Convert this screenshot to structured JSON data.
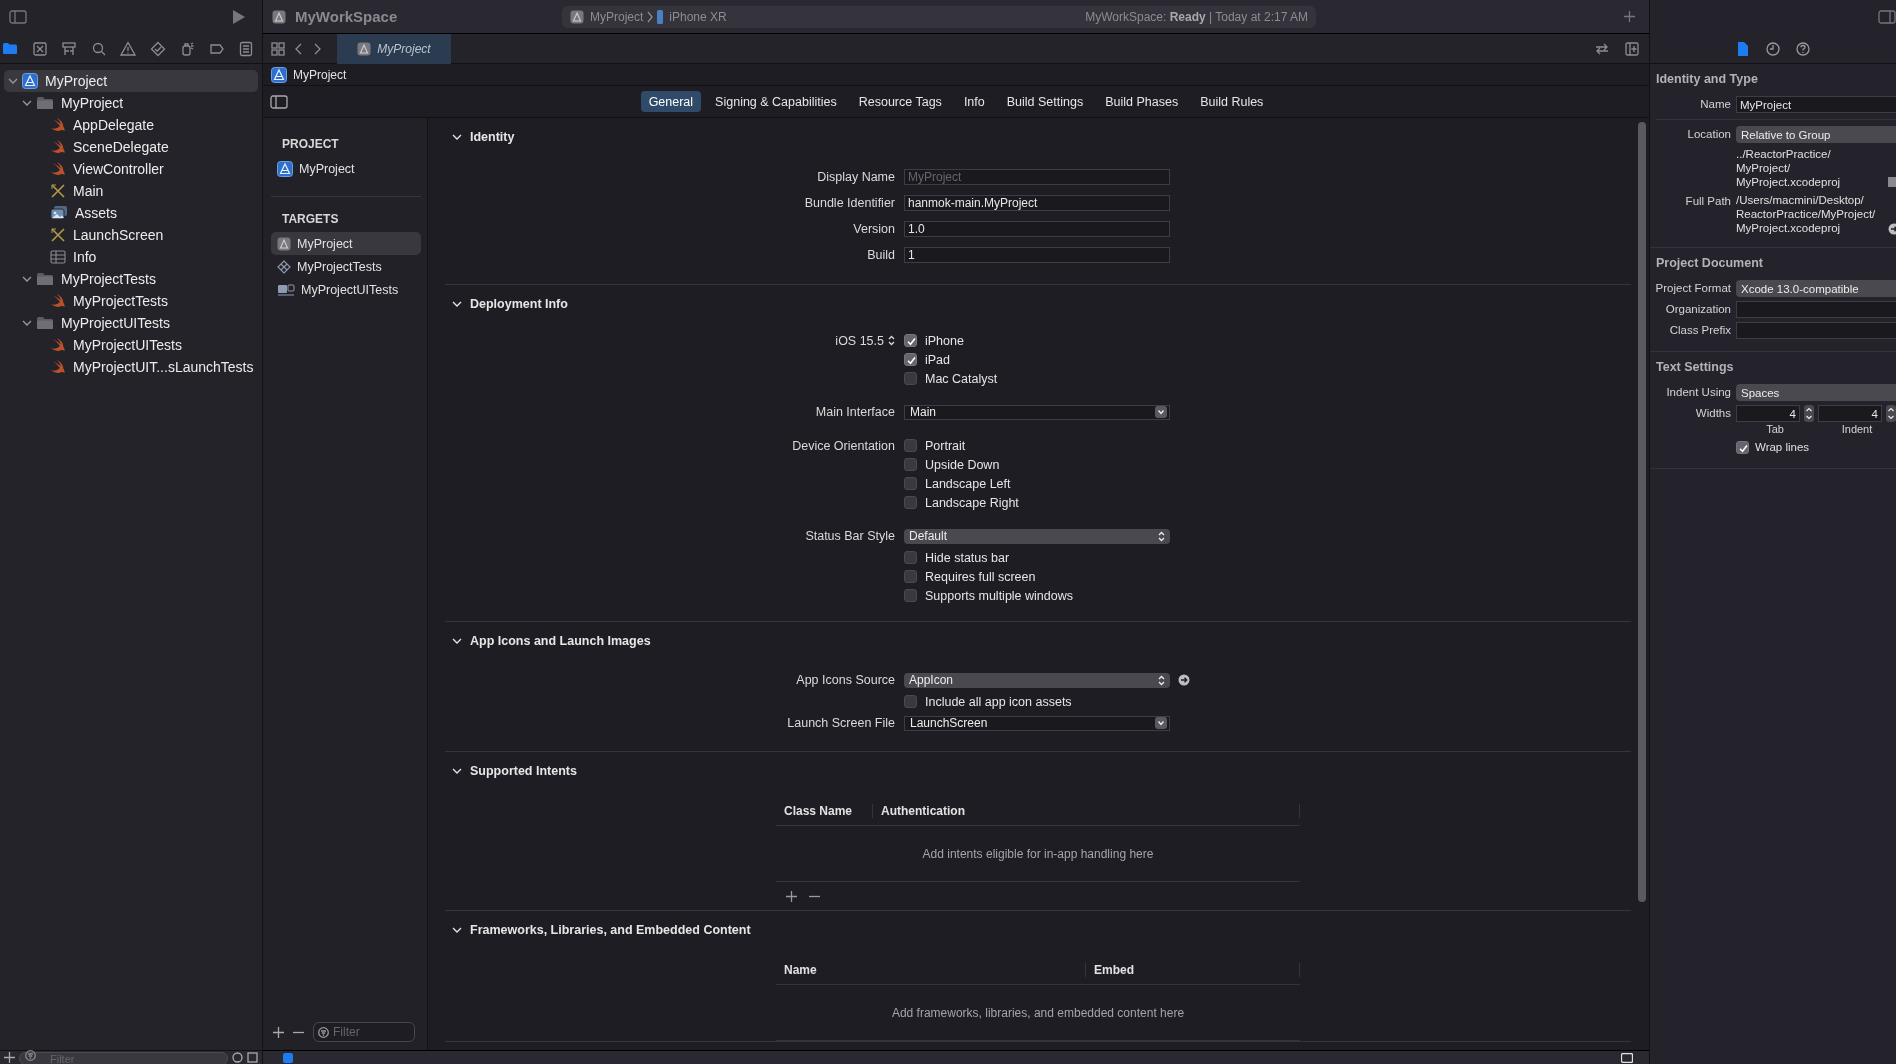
{
  "toolbar": {
    "workspace_title": "MyWorkSpace",
    "scheme": "MyProject",
    "destination": "iPhone XR",
    "status": "MyWorkSpace: **Ready** | Today at 2:17 AM"
  },
  "navigator": {
    "tabs": [
      {
        "kind": "folder",
        "selected": true
      },
      {
        "kind": "source-control",
        "selected": false
      },
      {
        "kind": "hierarchy",
        "selected": false
      },
      {
        "kind": "search",
        "selected": false
      },
      {
        "kind": "warning",
        "selected": false
      },
      {
        "kind": "test",
        "selected": false
      },
      {
        "kind": "debug",
        "selected": false
      },
      {
        "kind": "breakpoint",
        "selected": false
      },
      {
        "kind": "report",
        "selected": false
      }
    ],
    "tree": [
      {
        "name": "MyProject",
        "kind": "project",
        "selected": true,
        "expanded": true,
        "children": [
          {
            "name": "MyProject",
            "kind": "folder",
            "selected": false,
            "expanded": true,
            "children": [
              {
                "name": "AppDelegate",
                "kind": "swift",
                "selected": false
              },
              {
                "name": "SceneDelegate",
                "kind": "swift",
                "selected": false
              },
              {
                "name": "ViewController",
                "kind": "swift",
                "selected": false
              },
              {
                "name": "Main",
                "kind": "storyboard",
                "selected": false
              },
              {
                "name": "Assets",
                "kind": "assets",
                "selected": false
              },
              {
                "name": "LaunchScreen",
                "kind": "storyboard",
                "selected": false
              },
              {
                "name": "Info",
                "kind": "plist",
                "selected": false
              }
            ]
          },
          {
            "name": "MyProjectTests",
            "kind": "folder",
            "selected": false,
            "expanded": true,
            "children": [
              {
                "name": "MyProjectTests",
                "kind": "swift",
                "selected": false
              }
            ]
          },
          {
            "name": "MyProjectUITests",
            "kind": "folder",
            "selected": false,
            "expanded": true,
            "children": [
              {
                "name": "MyProjectUITests",
                "kind": "swift",
                "selected": false
              },
              {
                "name": "MyProjectUIT...sLaunchTests",
                "kind": "swift",
                "selected": false
              }
            ]
          }
        ]
      }
    ],
    "filter_placeholder": "Filter"
  },
  "editor_tabs": [
    {
      "title": "MyProject",
      "selected": true
    }
  ],
  "jump_bar": "MyProject",
  "settings_tabs": [
    {
      "label": "General",
      "selected": true
    },
    {
      "label": "Signing & Capabilities",
      "selected": false
    },
    {
      "label": "Resource Tags",
      "selected": false
    },
    {
      "label": "Info",
      "selected": false
    },
    {
      "label": "Build Settings",
      "selected": false
    },
    {
      "label": "Build Phases",
      "selected": false
    },
    {
      "label": "Build Rules",
      "selected": false
    }
  ],
  "project_list": {
    "project_heading": "PROJECT",
    "projects": [
      {
        "name": "MyProject",
        "kind": "project",
        "selected": false
      }
    ],
    "targets_heading": "TARGETS",
    "targets": [
      {
        "name": "MyProject",
        "kind": "app",
        "selected": true
      },
      {
        "name": "MyProjectTests",
        "kind": "unit-tests",
        "selected": false
      },
      {
        "name": "MyProjectUITests",
        "kind": "ui-tests",
        "selected": false
      }
    ],
    "filter_placeholder": "Filter"
  },
  "sections": [
    {
      "title": "Identity",
      "expanded": true,
      "groups": [
        [
          {
            "kind": "text-field",
            "label": "Display Name",
            "placeholder": "MyProject"
          },
          {
            "kind": "text-field",
            "label": "Bundle Identifier",
            "value": "hanmok-main.MyProject"
          },
          {
            "kind": "text-field",
            "label": "Version",
            "value": "1.0"
          },
          {
            "kind": "text-field",
            "label": "Build",
            "value": "1"
          }
        ]
      ]
    },
    {
      "title": "Deployment Info",
      "expanded": true,
      "groups": [
        [
          {
            "kind": "deployment-target",
            "label": "iOS 15.5",
            "text": "iPhone",
            "checked": true
          },
          {
            "kind": "checkbox",
            "text": "iPad",
            "checked": true
          },
          {
            "kind": "checkbox",
            "text": "Mac Catalyst",
            "checked": false
          }
        ],
        [
          {
            "kind": "combo",
            "label": "Main Interface",
            "value": "Main"
          }
        ],
        [
          {
            "kind": "checkbox",
            "label": "Device Orientation",
            "text": "Portrait",
            "checked": false
          },
          {
            "kind": "checkbox",
            "text": "Upside Down",
            "checked": false
          },
          {
            "kind": "checkbox",
            "text": "Landscape Left",
            "checked": false
          },
          {
            "kind": "checkbox",
            "text": "Landscape Right",
            "checked": false
          }
        ],
        [
          {
            "kind": "popup",
            "label": "Status Bar Style",
            "value": "Default"
          },
          {
            "kind": "checkbox",
            "text": "Hide status bar",
            "checked": false
          },
          {
            "kind": "checkbox",
            "text": "Requires full screen",
            "checked": false
          },
          {
            "kind": "checkbox",
            "text": "Supports multiple windows",
            "checked": false
          }
        ]
      ]
    },
    {
      "title": "App Icons and Launch Images",
      "expanded": true,
      "groups": [
        [
          {
            "kind": "popup-link",
            "label": "App Icons Source",
            "value": "AppIcon"
          },
          {
            "kind": "checkbox",
            "text": "Include all app icon assets",
            "checked": false
          },
          {
            "kind": "combo",
            "label": "Launch Screen File",
            "value": "LaunchScreen"
          }
        ]
      ]
    },
    {
      "title": "Supported Intents",
      "expanded": true,
      "table": {
        "columns": [
          "Class Name",
          "Authentication"
        ],
        "empty_message": "Add intents eligible for in-app handling here",
        "add_remove_buttons": true
      }
    },
    {
      "title": "Frameworks, Libraries, and Embedded Content",
      "expanded": true,
      "table": {
        "columns": [
          "Name",
          "Embed"
        ],
        "empty_message": "Add frameworks, libraries, and embedded content here"
      }
    }
  ],
  "inspector": {
    "tabs": [
      {
        "kind": "file",
        "selected": true
      },
      {
        "kind": "history",
        "selected": false
      },
      {
        "kind": "help",
        "selected": false
      }
    ],
    "sections": [
      {
        "title": "Identity and Type",
        "rows": [
          {
            "kind": "text-field",
            "label": "Name",
            "value": "MyProject"
          },
          {
            "kind": "divider"
          },
          {
            "kind": "popup",
            "label": "Location",
            "value": "Relative to Group"
          },
          {
            "kind": "path",
            "lines": [
              "../ReactorPractice/",
              "MyProject/",
              "MyProject.xcodeproj"
            ]
          },
          {
            "kind": "path-link",
            "label": "Full Path",
            "lines": [
              "/Users/macmini/Desktop/",
              "ReactorPractice/MyProject/",
              "MyProject.xcodeproj"
            ]
          }
        ]
      },
      {
        "title": "Project Document",
        "rows": [
          {
            "kind": "popup",
            "label": "Project Format",
            "value": "Xcode 13.0-compatible"
          },
          {
            "kind": "text-field",
            "label": "Organization"
          },
          {
            "kind": "text-field",
            "label": "Class Prefix"
          }
        ]
      },
      {
        "title": "Text Settings",
        "rows": [
          {
            "kind": "popup",
            "label": "Indent Using",
            "value": "Spaces"
          },
          {
            "kind": "widths",
            "label": "Widths",
            "fields": [
              {
                "value": "4",
                "caption": "Tab"
              },
              {
                "value": "4",
                "caption": "Indent"
              }
            ]
          },
          {
            "kind": "checkbox",
            "text": "Wrap lines",
            "checked": true
          }
        ]
      }
    ]
  }
}
